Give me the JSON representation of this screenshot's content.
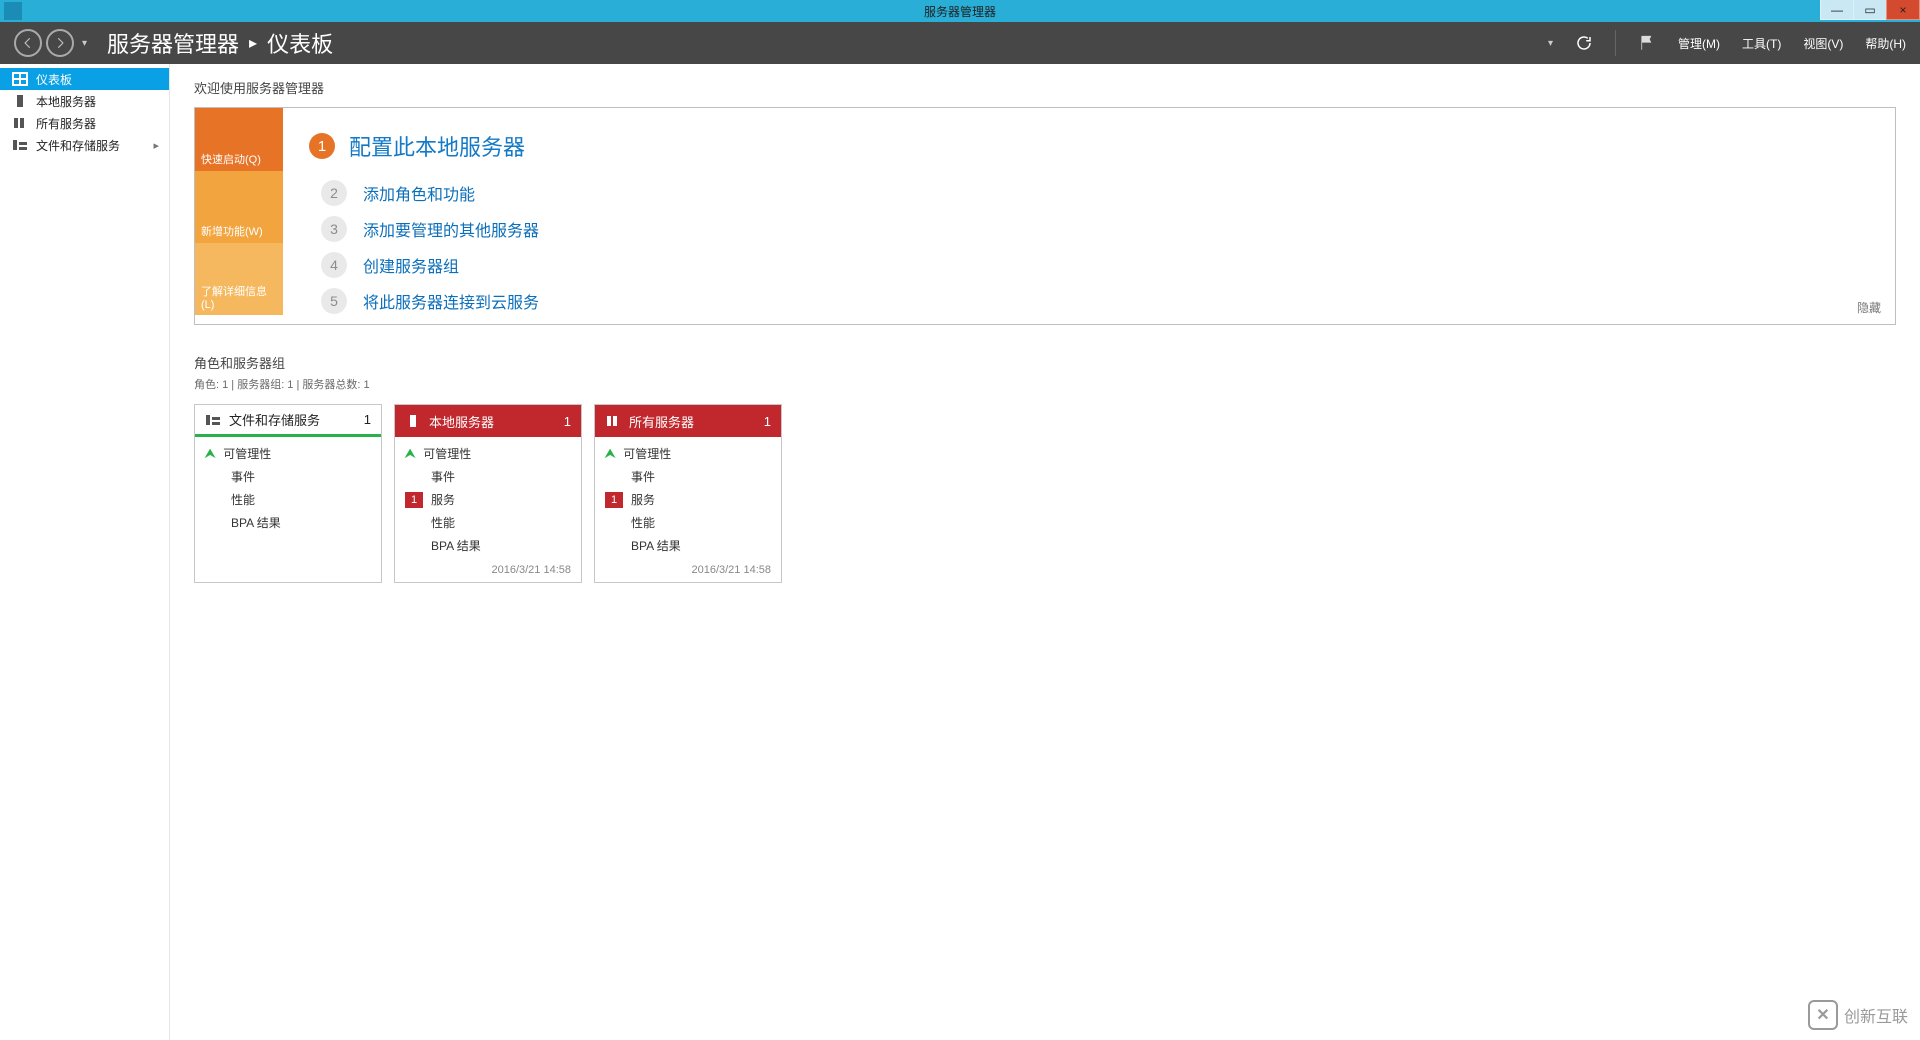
{
  "window": {
    "title": "服务器管理器",
    "min": "—",
    "max": "▭",
    "close": "×"
  },
  "header": {
    "app": "服务器管理器",
    "page": "仪表板",
    "menus": {
      "manage": "管理(M)",
      "tools": "工具(T)",
      "view": "视图(V)",
      "help": "帮助(H)"
    }
  },
  "sidebar": {
    "items": [
      {
        "icon": "dashboard",
        "label": "仪表板"
      },
      {
        "icon": "server",
        "label": "本地服务器"
      },
      {
        "icon": "servers",
        "label": "所有服务器"
      },
      {
        "icon": "files",
        "label": "文件和存储服务",
        "chevron": true
      }
    ]
  },
  "welcome": {
    "title": "欢迎使用服务器管理器",
    "tabs": {
      "quick": "快速启动(Q)",
      "whats": "新增功能(W)",
      "learn": "了解详细信息(L)"
    },
    "step1_num": "1",
    "step1_label": "配置此本地服务器",
    "subs": [
      {
        "n": "2",
        "t": "添加角色和功能"
      },
      {
        "n": "3",
        "t": "添加要管理的其他服务器"
      },
      {
        "n": "4",
        "t": "创建服务器组"
      },
      {
        "n": "5",
        "t": "将此服务器连接到云服务"
      }
    ],
    "hide": "隐藏"
  },
  "roles": {
    "title": "角色和服务器组",
    "sub": "角色: 1 | 服务器组: 1 | 服务器总数: 1",
    "tiles": [
      {
        "kind": "good",
        "icon": "files",
        "title": "文件和存储服务",
        "count": "1",
        "rows": [
          {
            "up": true,
            "label": "可管理性"
          },
          {
            "label": "事件"
          },
          {
            "label": "性能"
          },
          {
            "label": "BPA 结果"
          }
        ],
        "timestamp": ""
      },
      {
        "kind": "bad",
        "icon": "server",
        "title": "本地服务器",
        "count": "1",
        "rows": [
          {
            "up": true,
            "label": "可管理性"
          },
          {
            "label": "事件"
          },
          {
            "badge": "1",
            "label": "服务"
          },
          {
            "label": "性能"
          },
          {
            "label": "BPA 结果"
          }
        ],
        "timestamp": "2016/3/21 14:58"
      },
      {
        "kind": "bad",
        "icon": "servers",
        "title": "所有服务器",
        "count": "1",
        "rows": [
          {
            "up": true,
            "label": "可管理性"
          },
          {
            "label": "事件"
          },
          {
            "badge": "1",
            "label": "服务"
          },
          {
            "label": "性能"
          },
          {
            "label": "BPA 结果"
          }
        ],
        "timestamp": "2016/3/21 14:58"
      }
    ]
  },
  "watermark": "创新互联"
}
